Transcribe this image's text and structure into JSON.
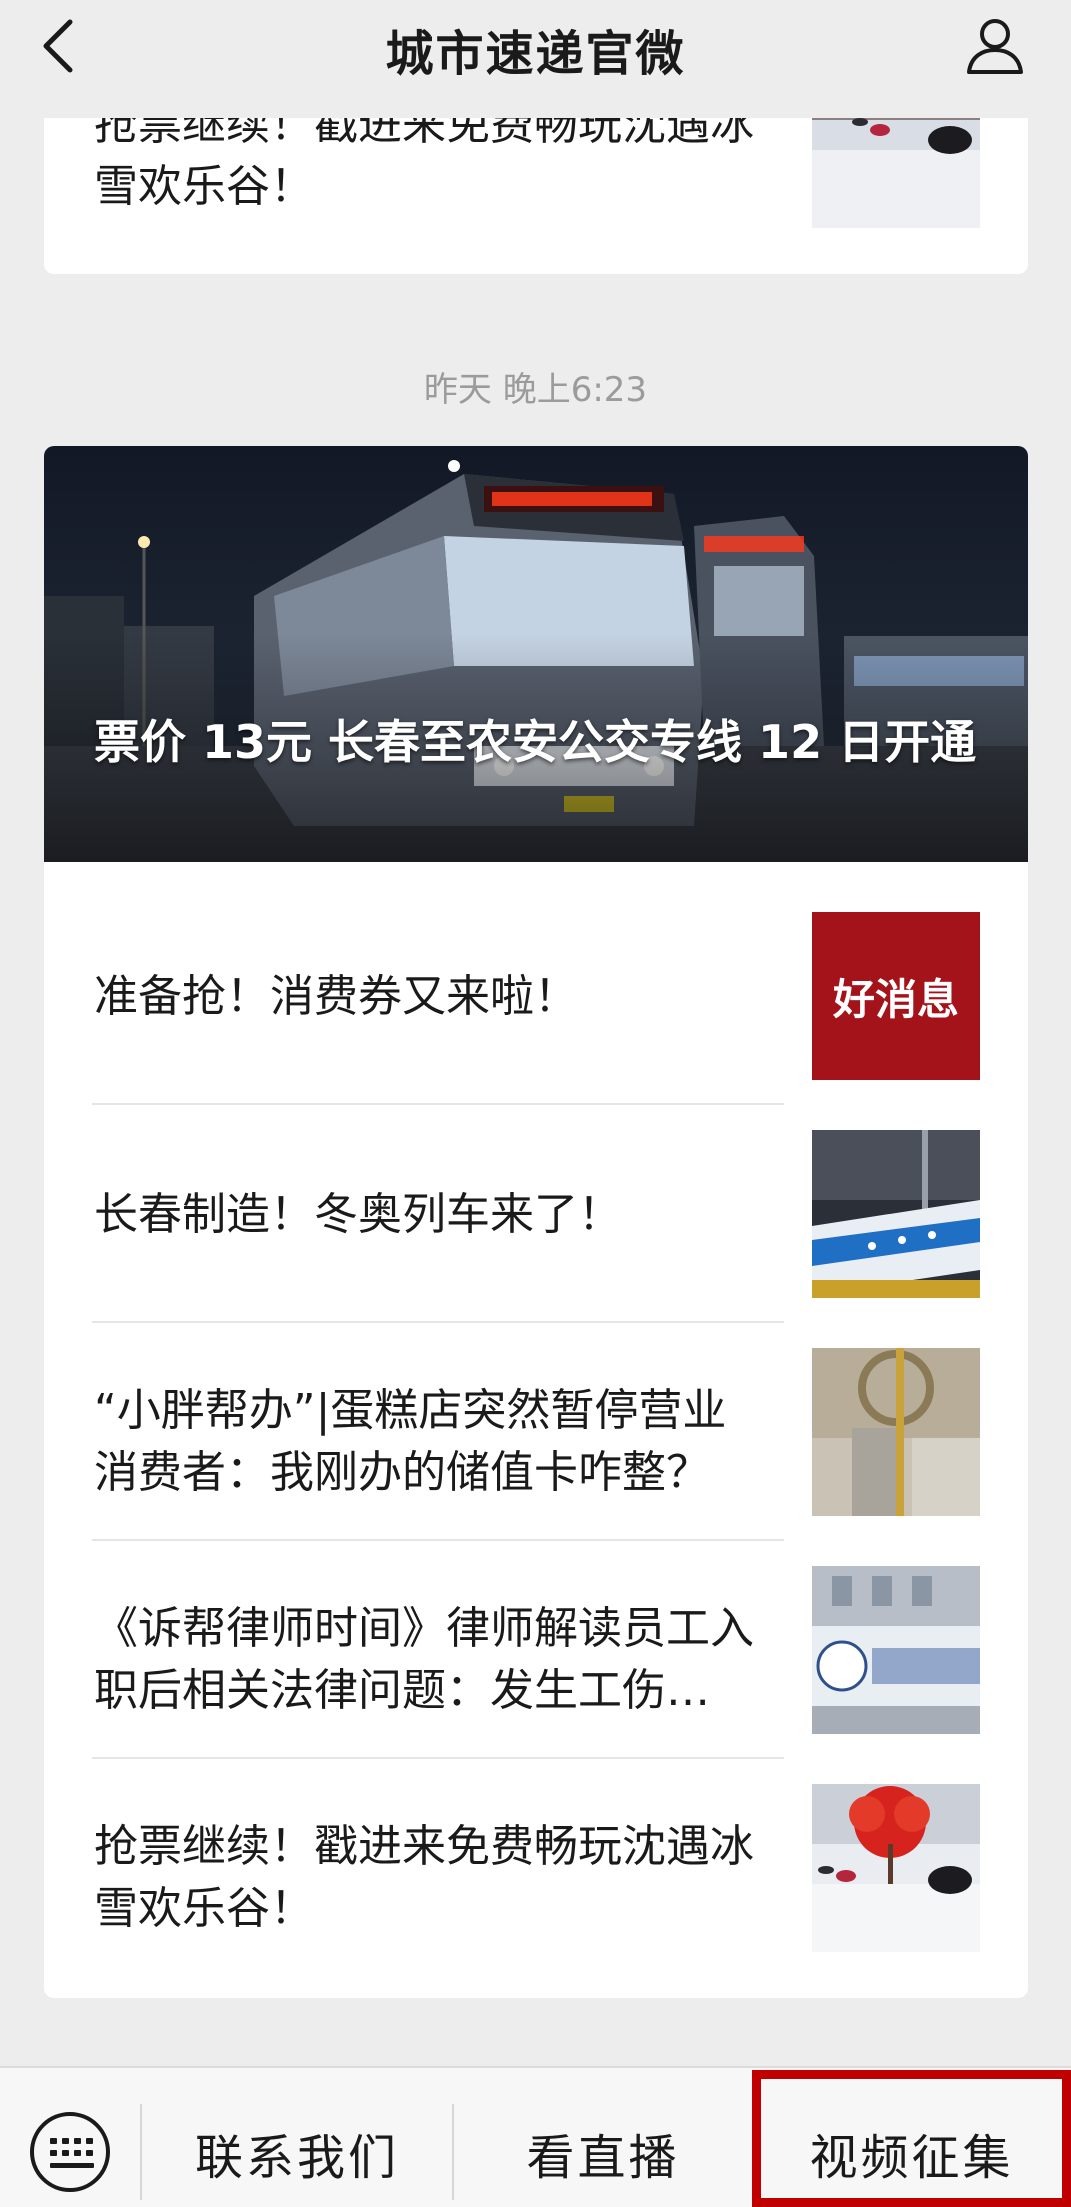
{
  "header": {
    "title": "城市速递官微"
  },
  "top_card": {
    "title": "抢票继续！戳进来免费畅玩沈遇冰雪欢乐谷！"
  },
  "timestamp": "昨天 晚上6:23",
  "hero": {
    "title": "票价 13元 长春至农安公交专线 12 日开通"
  },
  "articles": [
    {
      "title": "准备抢！消费券又来啦！",
      "thumb_text": "好消息"
    },
    {
      "title": "长春制造！冬奥列车来了！"
    },
    {
      "title": "“小胖帮办”|蛋糕店突然暂停营业 消费者：我刚办的储值卡咋整？"
    },
    {
      "title": "《诉帮律师时间》律师解读员工入职后相关法律问题：发生工伤…"
    },
    {
      "title": "抢票继续！戳进来免费畅玩沈遇冰雪欢乐谷！"
    }
  ],
  "bottom_menu": {
    "items": [
      {
        "label": "联系我们"
      },
      {
        "label": "看直播"
      },
      {
        "label": "视频征集"
      }
    ]
  },
  "colors": {
    "background": "#ededed",
    "card": "#ffffff",
    "highlight": "#c00000",
    "thumb_red": "#a4121a"
  },
  "icons": [
    "back-arrow-icon",
    "profile-icon",
    "keyboard-icon"
  ]
}
